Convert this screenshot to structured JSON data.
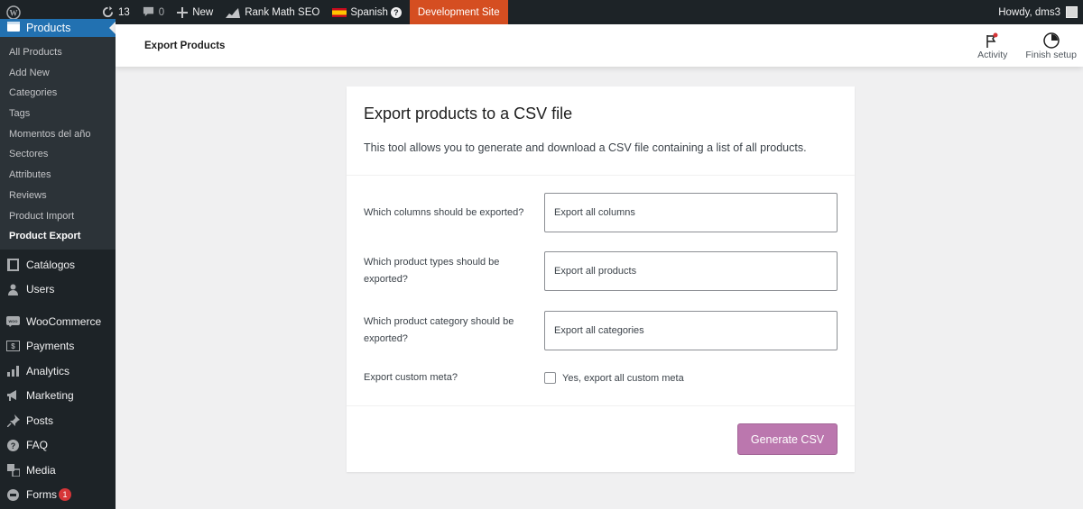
{
  "admin_bar": {
    "updates_count": "13",
    "comments_count": "0",
    "new_label": "New",
    "rank_math_label": "Rank Math SEO",
    "language_label": "Spanish",
    "dev_site_label": "Development Site",
    "greeting": "Howdy, dms3",
    "dev_site_color": "#d54e21"
  },
  "sidebar": {
    "current_menu": "Products",
    "submenu": [
      {
        "label": "All Products"
      },
      {
        "label": "Add New"
      },
      {
        "label": "Categories"
      },
      {
        "label": "Tags"
      },
      {
        "label": "Momentos del año"
      },
      {
        "label": "Sectores"
      },
      {
        "label": "Attributes"
      },
      {
        "label": "Reviews"
      },
      {
        "label": "Product Import"
      },
      {
        "label": "Product Export"
      }
    ],
    "menu": [
      {
        "label": "Catálogos",
        "icon": "book-icon"
      },
      {
        "label": "Users",
        "icon": "users-icon"
      },
      {
        "label": "WooCommerce",
        "icon": "woocommerce-icon"
      },
      {
        "label": "Payments",
        "icon": "payments-icon"
      },
      {
        "label": "Analytics",
        "icon": "analytics-icon"
      },
      {
        "label": "Marketing",
        "icon": "megaphone-icon"
      },
      {
        "label": "Posts",
        "icon": "pin-icon"
      },
      {
        "label": "FAQ",
        "icon": "help-icon"
      },
      {
        "label": "Media",
        "icon": "media-icon"
      },
      {
        "label": "Forms",
        "icon": "forms-icon",
        "badge": "1"
      }
    ]
  },
  "header": {
    "title": "Export Products",
    "activity_label": "Activity",
    "finish_setup_label": "Finish setup"
  },
  "card": {
    "title": "Export products to a CSV file",
    "description": "This tool allows you to generate and download a CSV file containing a list of all products.",
    "fields": [
      {
        "label": "Which columns should be exported?",
        "placeholder": "Export all columns"
      },
      {
        "label": "Which product types should be exported?",
        "placeholder": "Export all products"
      },
      {
        "label": "Which product category should be exported?",
        "placeholder": "Export all categories"
      }
    ],
    "custom_meta": {
      "label": "Export custom meta?",
      "checkbox_label": "Yes, export all custom meta",
      "checked": false
    },
    "submit_label": "Generate CSV",
    "submit_color": "#bb77ae"
  }
}
